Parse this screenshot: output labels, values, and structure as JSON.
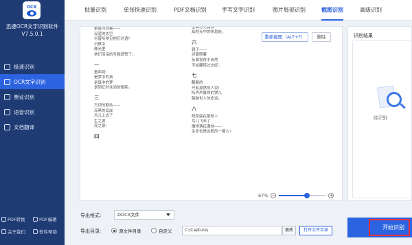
{
  "app": {
    "logo_text": "OCR",
    "name": "迅捷OCR文字识别软件",
    "version": "V7.5.0.1"
  },
  "sidebar": {
    "items": [
      {
        "label": "极速识别",
        "icon": "lightning-icon",
        "active": false
      },
      {
        "label": "OCR文字识别",
        "icon": "ocr-scan-icon",
        "active": true
      },
      {
        "label": "票证识别",
        "icon": "ticket-icon",
        "active": false
      },
      {
        "label": "语音识别",
        "icon": "microphone-icon",
        "active": false
      },
      {
        "label": "文档翻译",
        "icon": "translate-icon",
        "active": false
      }
    ],
    "bottom_links": [
      {
        "label": "PDF转换",
        "icon": "pdf-convert-icon"
      },
      {
        "label": "PDF编辑",
        "icon": "pdf-edit-icon"
      },
      {
        "label": "关于我们",
        "icon": "info-icon"
      },
      {
        "label": "软件帮助",
        "icon": "help-icon"
      }
    ]
  },
  "tabs": [
    {
      "label": "批量识别",
      "active": false
    },
    {
      "label": "单张快速识别",
      "active": false
    },
    {
      "label": "PDF文档识别",
      "active": false
    },
    {
      "label": "手写文字识别",
      "active": false
    },
    {
      "label": "图片局部识别",
      "active": false
    },
    {
      "label": "截图识别",
      "active": true
    },
    {
      "label": "高级识别",
      "active": false
    }
  ],
  "document": {
    "left_column": [
      "繁星闪烁着——",
      "深蓝的太空",
      "何曾听得见他们对语?",
      "沉默中",
      "微光里",
      "他们深深的互相颂赞了。",
      "一",
      "童年呵!",
      "是梦中的真",
      "是真中的梦",
      "是回忆时含泪的微笑。",
      "三",
      "万顷的颠动——",
      "深黑的岛岸",
      "月儿上去了",
      "生之源",
      "死之泉!",
      "四"
    ],
    "right_column": [
      "小孩子的花园",
      "里面灯光黯淡",
      "灿然光中的休息处。",
      "六",
      "镜子——",
      "对面照着",
      "反面觉得不自然",
      "不如翻转过去好。",
      "七",
      "醒着的",
      "只有孤愤的人类!",
      "听声声算命的锣儿",
      "敲破世人的命运。",
      "八",
      "残花缀在繁枝上",
      "鸟儿飞去了",
      "撒得落红满地——",
      "生命也是这般的一瞥么?"
    ]
  },
  "doc_buttons": {
    "recapture": "重新截图（ALT+F）",
    "delete": "删除"
  },
  "zoom": {
    "percent_label": "67%",
    "level": 0.6,
    "minus": "−",
    "plus": "+"
  },
  "result": {
    "title": "识别结果",
    "pending": "待识别"
  },
  "export": {
    "format_label": "导出格式:",
    "format_value": "DOCX文件",
    "dir_label": "导出目录:",
    "radio_source": "源文件目录",
    "radio_custom": "自定义",
    "path_value": "C:\\Capture\\",
    "change_button": "更改",
    "open_button": "打开文件目录"
  },
  "start_button": "开始识别",
  "colors": {
    "sidebar": "#1f3b73",
    "accent": "#2c63e0",
    "highlight": "#e8323c"
  }
}
